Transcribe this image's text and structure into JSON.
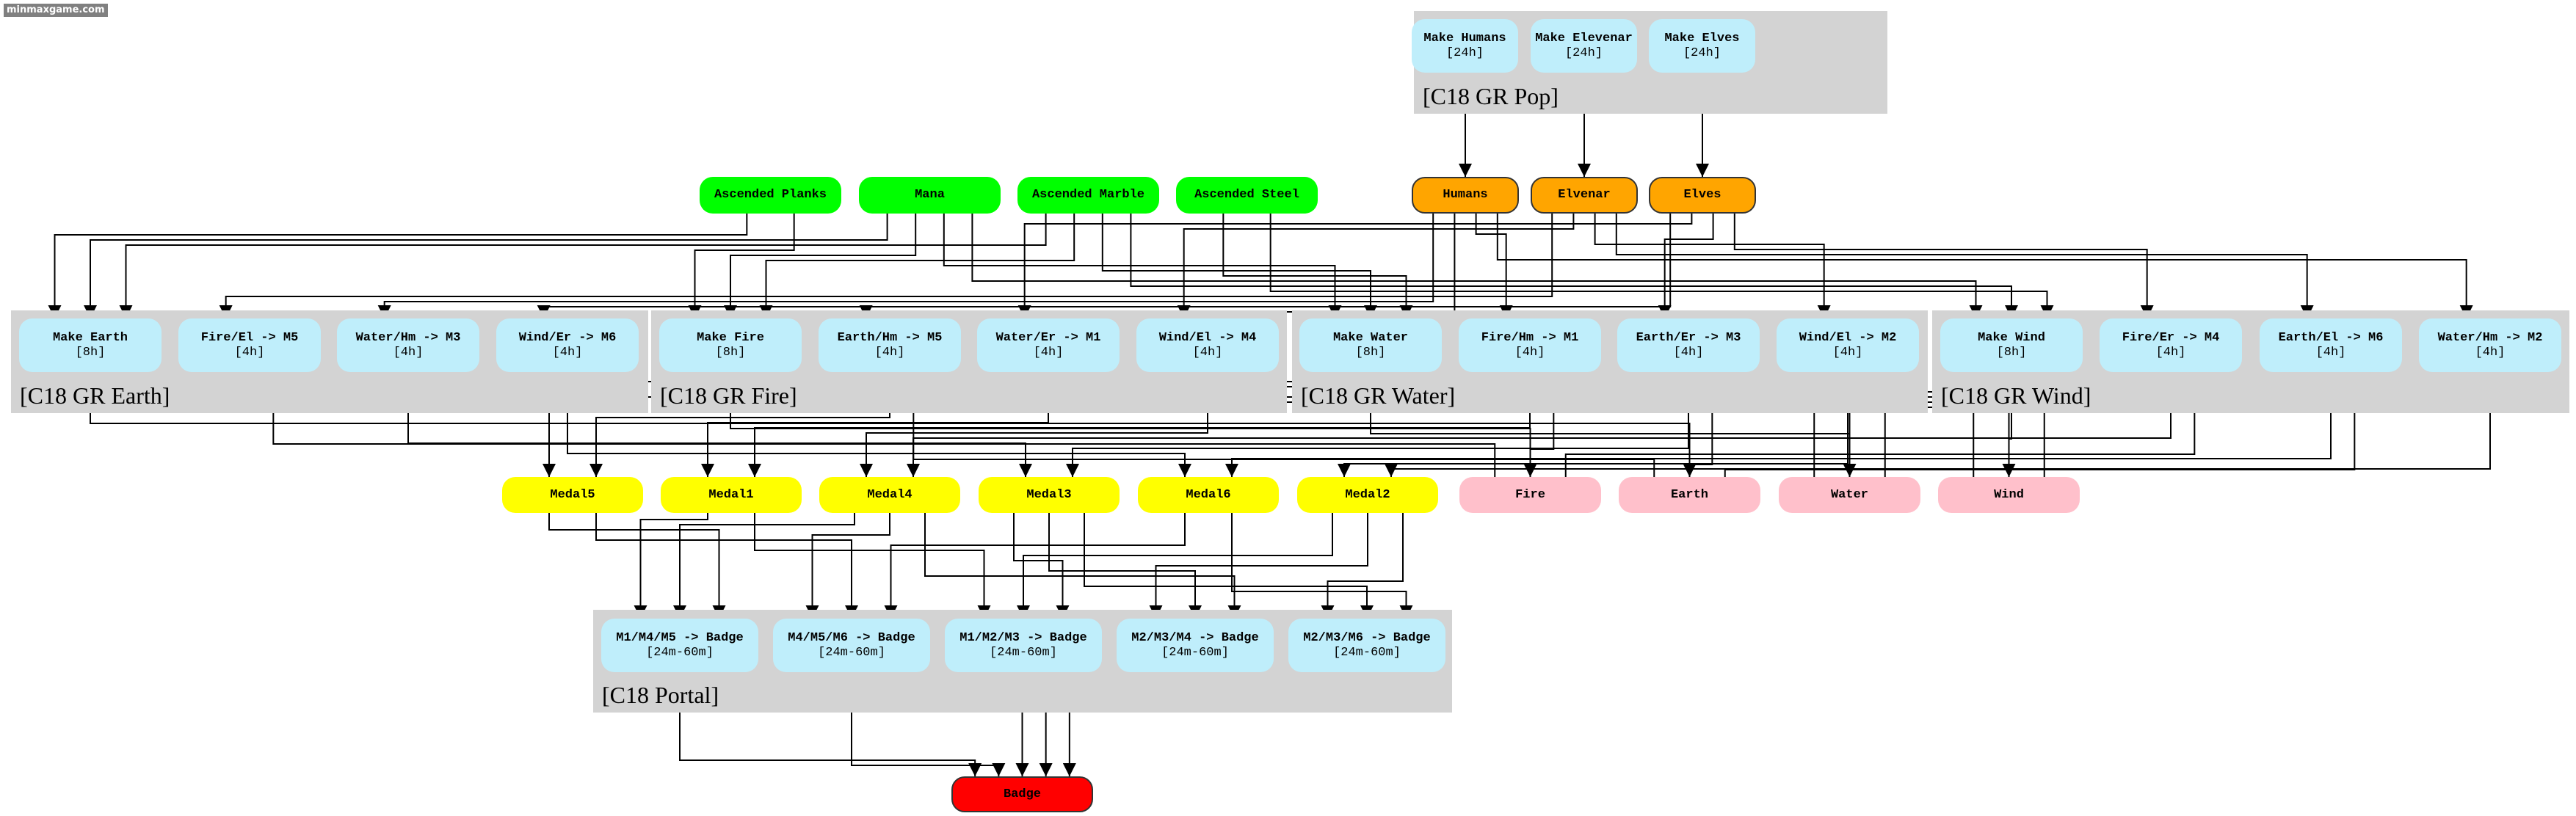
{
  "watermark": "minmaxgame.com",
  "clusters": {
    "pop": {
      "label": "[C18 GR Pop]"
    },
    "earth": {
      "label": "[C18 GR Earth]"
    },
    "fire": {
      "label": "[C18 GR Fire]"
    },
    "water": {
      "label": "[C18 GR Water]"
    },
    "wind": {
      "label": "[C18 GR Wind]"
    },
    "portal": {
      "label": "[C18 Portal]"
    }
  },
  "nodes": {
    "make_humans": {
      "title": "Make Humans",
      "duration": "[24h]"
    },
    "make_elvenar": {
      "title": "Make Elevenar",
      "duration": "[24h]"
    },
    "make_elves": {
      "title": "Make Elves",
      "duration": "[24h]"
    },
    "asc_planks": {
      "title": "Ascended Planks"
    },
    "mana": {
      "title": "Mana"
    },
    "asc_marble": {
      "title": "Ascended Marble"
    },
    "asc_steel": {
      "title": "Ascended Steel"
    },
    "humans": {
      "title": "Humans"
    },
    "elvenar": {
      "title": "Elvenar"
    },
    "elves": {
      "title": "Elves"
    },
    "make_earth": {
      "title": "Make Earth",
      "duration": "[8h]"
    },
    "fire_el_m5": {
      "title": "Fire/El -> M5",
      "duration": "[4h]"
    },
    "water_hm_m3": {
      "title": "Water/Hm -> M3",
      "duration": "[4h]"
    },
    "wind_er_m6": {
      "title": "Wind/Er -> M6",
      "duration": "[4h]"
    },
    "make_fire": {
      "title": "Make Fire",
      "duration": "[8h]"
    },
    "earth_hm_m5": {
      "title": "Earth/Hm -> M5",
      "duration": "[4h]"
    },
    "water_er_m1": {
      "title": "Water/Er -> M1",
      "duration": "[4h]"
    },
    "wind_el_m4": {
      "title": "Wind/El -> M4",
      "duration": "[4h]"
    },
    "make_water": {
      "title": "Make Water",
      "duration": "[8h]"
    },
    "fire_hm_m1": {
      "title": "Fire/Hm -> M1",
      "duration": "[4h]"
    },
    "earth_er_m3": {
      "title": "Earth/Er -> M3",
      "duration": "[4h]"
    },
    "wind_el_m2": {
      "title": "Wind/El -> M2",
      "duration": "[4h]"
    },
    "make_wind": {
      "title": "Make Wind",
      "duration": "[8h]"
    },
    "fire_er_m4": {
      "title": "Fire/Er -> M4",
      "duration": "[4h]"
    },
    "earth_el_m6": {
      "title": "Earth/El -> M6",
      "duration": "[4h]"
    },
    "water_hm_m2": {
      "title": "Water/Hm -> M2",
      "duration": "[4h]"
    },
    "medal5": {
      "title": "Medal5"
    },
    "medal1": {
      "title": "Medal1"
    },
    "medal4": {
      "title": "Medal4"
    },
    "medal3": {
      "title": "Medal3"
    },
    "medal6": {
      "title": "Medal6"
    },
    "medal2": {
      "title": "Medal2"
    },
    "fire": {
      "title": "Fire"
    },
    "earth": {
      "title": "Earth"
    },
    "water": {
      "title": "Water"
    },
    "wind": {
      "title": "Wind"
    },
    "b_m1m4m5": {
      "title": "M1/M4/M5 -> Badge",
      "duration": "[24m-60m]"
    },
    "b_m4m5m6": {
      "title": "M4/M5/M6 -> Badge",
      "duration": "[24m-60m]"
    },
    "b_m1m2m3": {
      "title": "M1/M2/M3 -> Badge",
      "duration": "[24m-60m]"
    },
    "b_m2m3m4": {
      "title": "M2/M3/M4 -> Badge",
      "duration": "[24m-60m]"
    },
    "b_m2m3m6": {
      "title": "M2/M3/M6 -> Badge",
      "duration": "[24m-60m]"
    },
    "badge": {
      "title": "Badge"
    }
  },
  "edges": [
    [
      "make_humans",
      "humans"
    ],
    [
      "make_elvenar",
      "elvenar"
    ],
    [
      "make_elves",
      "elves"
    ],
    [
      "asc_planks",
      "make_earth"
    ],
    [
      "mana",
      "make_earth"
    ],
    [
      "asc_marble",
      "make_earth"
    ],
    [
      "asc_planks",
      "make_fire"
    ],
    [
      "mana",
      "make_fire"
    ],
    [
      "asc_marble",
      "make_fire"
    ],
    [
      "mana",
      "make_water"
    ],
    [
      "asc_marble",
      "make_water"
    ],
    [
      "asc_steel",
      "make_water"
    ],
    [
      "mana",
      "make_wind"
    ],
    [
      "asc_marble",
      "make_wind"
    ],
    [
      "asc_steel",
      "make_wind"
    ],
    [
      "elvenar",
      "fire_el_m5"
    ],
    [
      "humans",
      "water_hm_m3"
    ],
    [
      "elves",
      "wind_er_m6"
    ],
    [
      "humans",
      "earth_hm_m5"
    ],
    [
      "elves",
      "water_er_m1"
    ],
    [
      "elvenar",
      "wind_el_m4"
    ],
    [
      "humans",
      "fire_hm_m1"
    ],
    [
      "elves",
      "earth_er_m3"
    ],
    [
      "elvenar",
      "wind_el_m2"
    ],
    [
      "elves",
      "fire_er_m4"
    ],
    [
      "elvenar",
      "earth_el_m6"
    ],
    [
      "humans",
      "water_hm_m2"
    ],
    [
      "make_earth",
      "earth"
    ],
    [
      "make_fire",
      "fire"
    ],
    [
      "make_water",
      "water"
    ],
    [
      "make_wind",
      "wind"
    ],
    [
      "fire",
      "fire_el_m5"
    ],
    [
      "fire",
      "fire_hm_m1"
    ],
    [
      "fire",
      "fire_er_m4"
    ],
    [
      "earth",
      "earth_hm_m5"
    ],
    [
      "earth",
      "earth_er_m3"
    ],
    [
      "earth",
      "earth_el_m6"
    ],
    [
      "water",
      "water_hm_m3"
    ],
    [
      "water",
      "water_er_m1"
    ],
    [
      "water",
      "water_hm_m2"
    ],
    [
      "wind",
      "wind_er_m6"
    ],
    [
      "wind",
      "wind_el_m4"
    ],
    [
      "wind",
      "wind_el_m2"
    ],
    [
      "fire_el_m5",
      "medal5"
    ],
    [
      "earth_hm_m5",
      "medal5"
    ],
    [
      "water_er_m1",
      "medal1"
    ],
    [
      "fire_hm_m1",
      "medal1"
    ],
    [
      "wind_el_m4",
      "medal4"
    ],
    [
      "fire_er_m4",
      "medal4"
    ],
    [
      "water_hm_m3",
      "medal3"
    ],
    [
      "earth_er_m3",
      "medal3"
    ],
    [
      "wind_er_m6",
      "medal6"
    ],
    [
      "earth_el_m6",
      "medal6"
    ],
    [
      "wind_el_m2",
      "medal2"
    ],
    [
      "water_hm_m2",
      "medal2"
    ],
    [
      "medal1",
      "b_m1m4m5"
    ],
    [
      "medal4",
      "b_m1m4m5"
    ],
    [
      "medal5",
      "b_m1m4m5"
    ],
    [
      "medal4",
      "b_m4m5m6"
    ],
    [
      "medal5",
      "b_m4m5m6"
    ],
    [
      "medal6",
      "b_m4m5m6"
    ],
    [
      "medal1",
      "b_m1m2m3"
    ],
    [
      "medal2",
      "b_m1m2m3"
    ],
    [
      "medal3",
      "b_m1m2m3"
    ],
    [
      "medal2",
      "b_m2m3m4"
    ],
    [
      "medal3",
      "b_m2m3m4"
    ],
    [
      "medal4",
      "b_m2m3m4"
    ],
    [
      "medal2",
      "b_m2m3m6"
    ],
    [
      "medal3",
      "b_m2m3m6"
    ],
    [
      "medal6",
      "b_m2m3m6"
    ],
    [
      "b_m1m4m5",
      "badge"
    ],
    [
      "b_m4m5m6",
      "badge"
    ],
    [
      "b_m1m2m3",
      "badge"
    ],
    [
      "b_m2m3m4",
      "badge"
    ],
    [
      "b_m2m3m6",
      "badge"
    ]
  ]
}
